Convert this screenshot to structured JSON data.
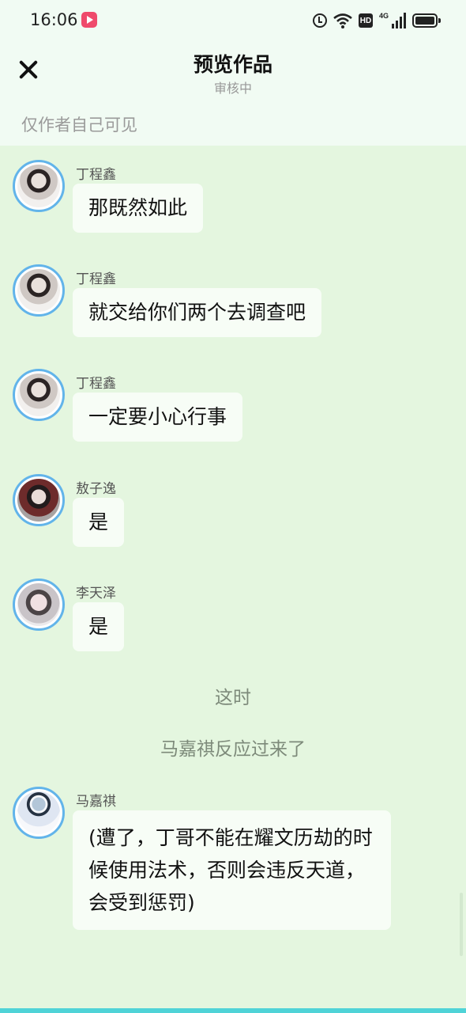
{
  "status_bar": {
    "time": "16:06",
    "icons": [
      "app-badge-icon",
      "alarm-icon",
      "wifi-icon",
      "hd-icon",
      "signal-4g-icon",
      "battery-icon"
    ],
    "network_label": "4G",
    "hd_label": "HD"
  },
  "header": {
    "title": "预览作品",
    "subtitle": "审核中",
    "visibility_note": "仅作者自己可见"
  },
  "messages": [
    {
      "type": "chat",
      "sender": "丁程鑫",
      "text": "那既然如此"
    },
    {
      "type": "chat",
      "sender": "丁程鑫",
      "text": "就交给你们两个去调查吧"
    },
    {
      "type": "chat",
      "sender": "丁程鑫",
      "text": "一定要小心行事"
    },
    {
      "type": "chat",
      "sender": "敖子逸",
      "text": "是"
    },
    {
      "type": "chat",
      "sender": "李天泽",
      "text": "是"
    },
    {
      "type": "narration",
      "text": "这时"
    },
    {
      "type": "narration",
      "text": "马嘉祺反应过来了"
    },
    {
      "type": "chat",
      "sender": "马嘉祺",
      "text": "(遭了，丁哥不能在耀文历劫的时候使用法术，否则会违反天道，会受到惩罚)"
    }
  ],
  "colors": {
    "header_bg": "#f1fbf3",
    "chat_bg": "#e4f6df",
    "bubble_bg": "#f7fdf6",
    "avatar_ring": "#62b4ea",
    "bottom_strip": "#4fd3d7"
  }
}
